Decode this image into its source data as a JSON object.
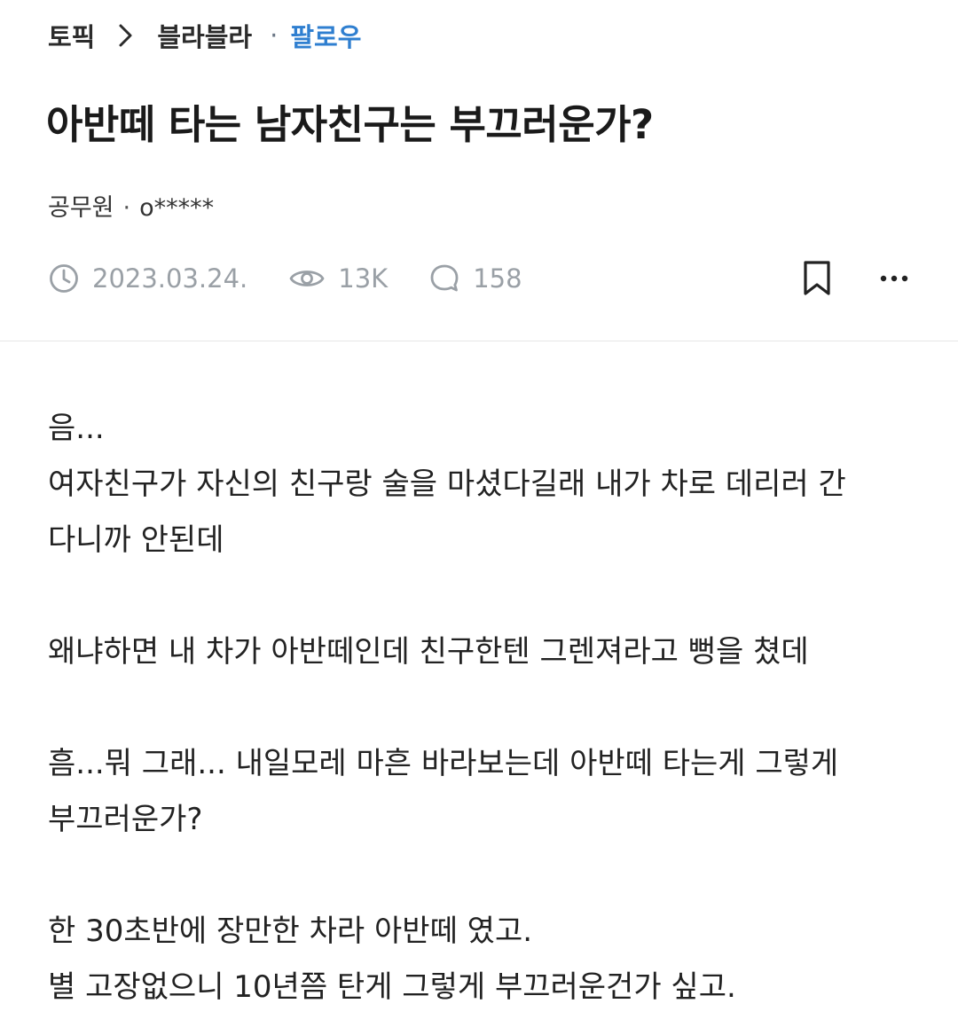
{
  "breadcrumb": {
    "topic": "토픽",
    "board": "블라블라",
    "follow": "팔로우",
    "separator": "·"
  },
  "post": {
    "title": "아반떼 타는 남자친구는 부끄러운가?",
    "author_company": "공무원",
    "author_sep": "·",
    "author_id": "o*****",
    "date": "2023.03.24.",
    "views": "13K",
    "comments": "158"
  },
  "icons": {
    "chevron": "chevron-right-icon",
    "clock": "clock-icon",
    "eye": "eye-icon",
    "comment": "comment-bubble-icon",
    "bookmark": "bookmark-icon",
    "more": "more-dots-icon"
  },
  "colors": {
    "accent": "#2f7fd0",
    "meta": "#9aa0a6",
    "text": "#222222"
  },
  "content": {
    "lines": [
      "음...",
      "여자친구가 자신의 친구랑 술을 마셨다길래 내가 차로 데리러 간",
      "다니까 안된데",
      "",
      "왜냐하면 내 차가 아반떼인데 친구한텐 그렌져라고 뻥을 쳤데",
      "",
      "흠...뭐 그래... 내일모레 마흔 바라보는데 아반떼 타는게 그렇게",
      "부끄러운가?",
      "",
      "한 30초반에 장만한 차라 아반떼 였고.",
      "별 고장없으니 10년쯤 탄게 그렇게 부끄러운건가 싶고."
    ]
  }
}
